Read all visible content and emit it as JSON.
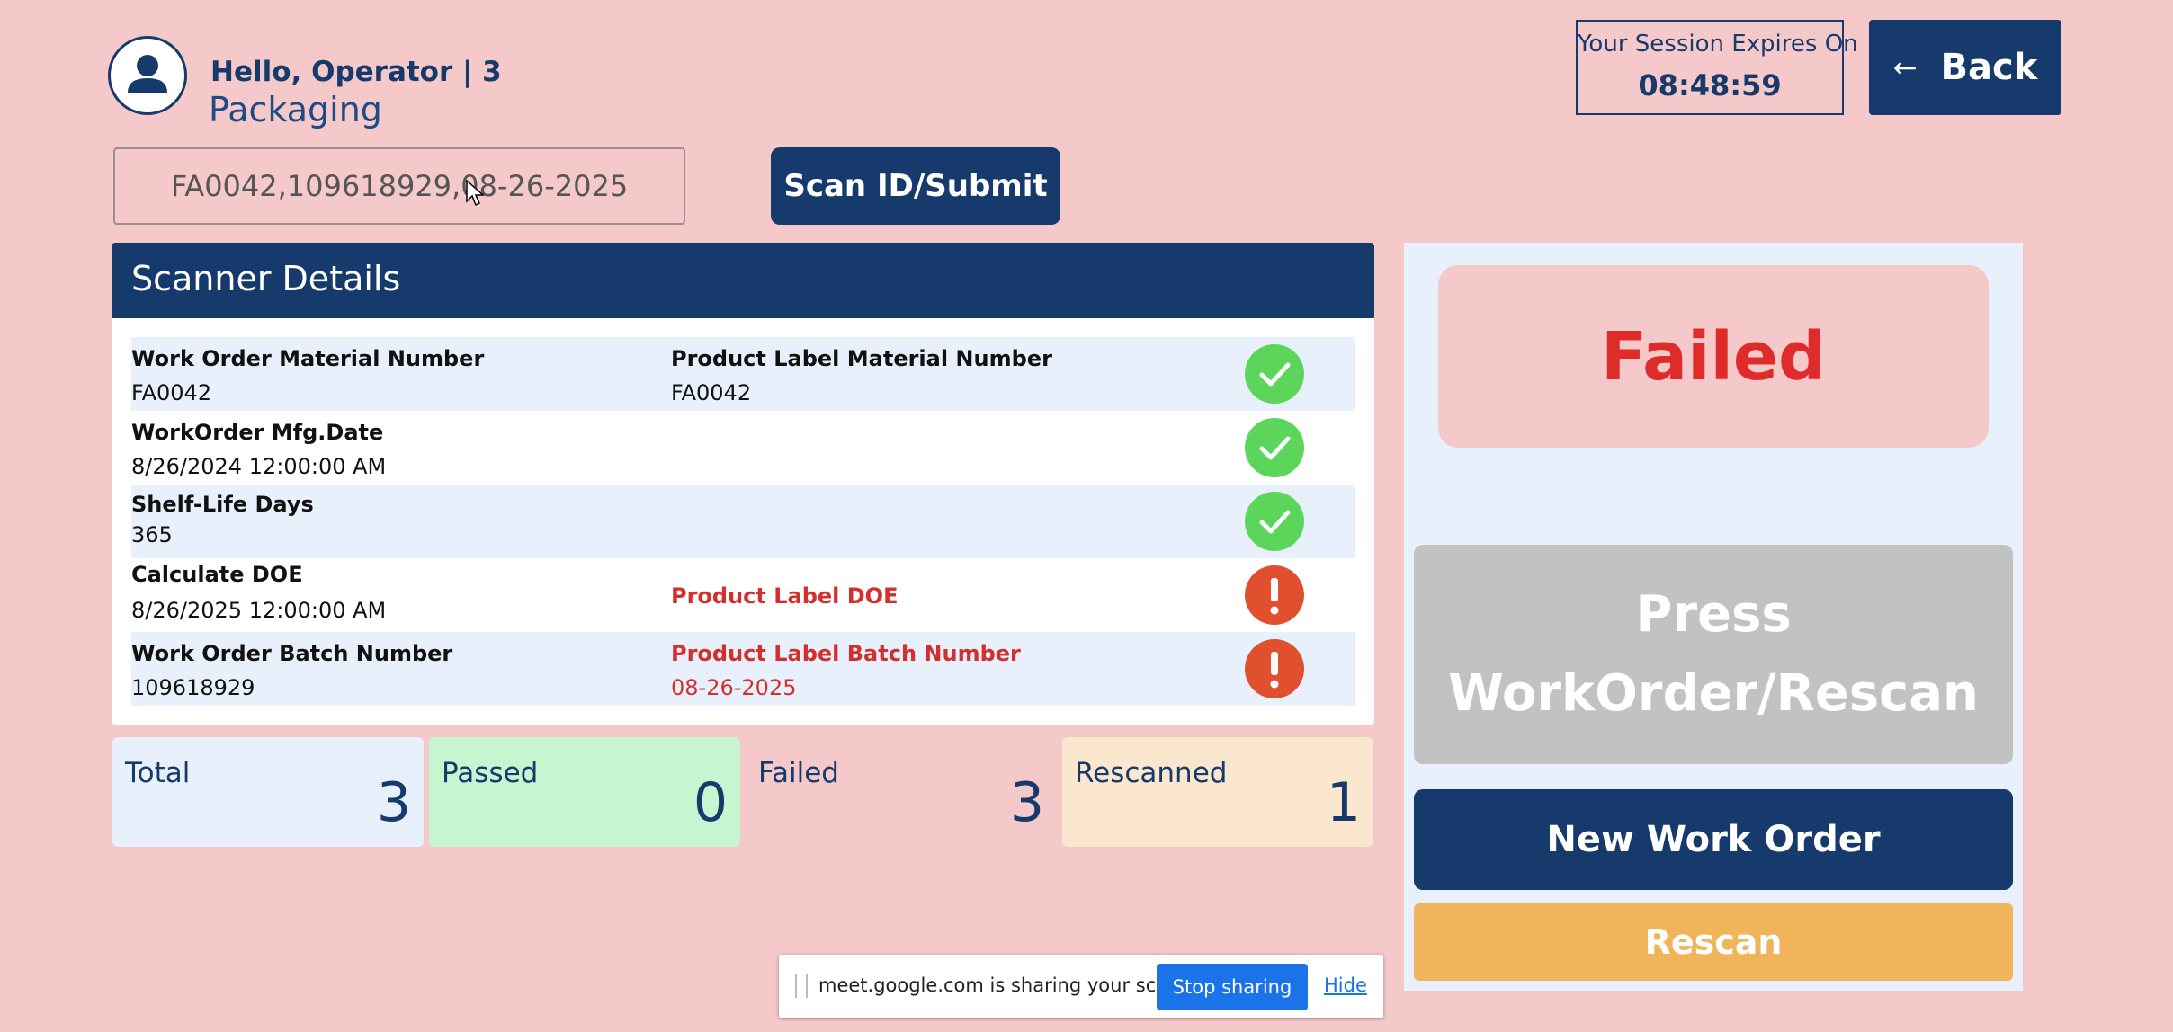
{
  "header": {
    "greeting": "Hello, Operator | 3",
    "department": "Packaging",
    "session_label": "Your Session Expires On",
    "session_time": "08:48:59",
    "back_arrow": "←",
    "back_label": "Back"
  },
  "scan": {
    "input_value": "FA0042,109618929,08-26-2025",
    "button_label": "Scan ID/Submit"
  },
  "scanner_details": {
    "title": "Scanner Details",
    "rows": [
      {
        "left_label": "Work Order Material Number",
        "left_value": "FA0042",
        "right_label": "Product Label Material Number",
        "right_value": "FA0042",
        "status": "ok",
        "icon": "check-icon"
      },
      {
        "left_label": "WorkOrder Mfg.Date",
        "left_value": "8/26/2024 12:00:00 AM",
        "right_label": "",
        "right_value": "",
        "status": "ok",
        "icon": "check-icon"
      },
      {
        "left_label": "Shelf-Life Days",
        "left_value": "365",
        "right_label": "",
        "right_value": "",
        "status": "ok",
        "icon": "check-icon"
      },
      {
        "left_label": "Calculate DOE",
        "left_value": "8/26/2025 12:00:00 AM",
        "right_label": "Product Label DOE",
        "right_value": "",
        "status": "error",
        "icon": "exclamation-icon"
      },
      {
        "left_label": "Work Order Batch Number",
        "left_value": "109618929",
        "right_label": "Product Label Batch Number",
        "right_value": "08-26-2025",
        "status": "error",
        "icon": "exclamation-icon"
      }
    ]
  },
  "stats": {
    "total": {
      "label": "Total",
      "value": "3",
      "color": "#e8f1fb"
    },
    "passed": {
      "label": "Passed",
      "value": "0",
      "color": "#c6f5d0"
    },
    "failed": {
      "label": "Failed",
      "value": "3",
      "color": "#f5c8ca"
    },
    "rescanned": {
      "label": "Rescanned",
      "value": "1",
      "color": "#fae7cd"
    }
  },
  "result": {
    "status": "Failed",
    "instruction_line1": "Press",
    "instruction_line2": "WorkOrder/Rescan",
    "new_work_order_label": "New Work Order",
    "rescan_label": "Rescan"
  },
  "share_banner": {
    "message": "meet.google.com is sharing your screen.",
    "stop_label": "Stop sharing",
    "hide_label": "Hide"
  },
  "colors": {
    "background": "#f5c8ca",
    "primary": "#163a6b",
    "success": "#5cd65a",
    "error": "#e0502e",
    "warning": "#f0b45a"
  }
}
